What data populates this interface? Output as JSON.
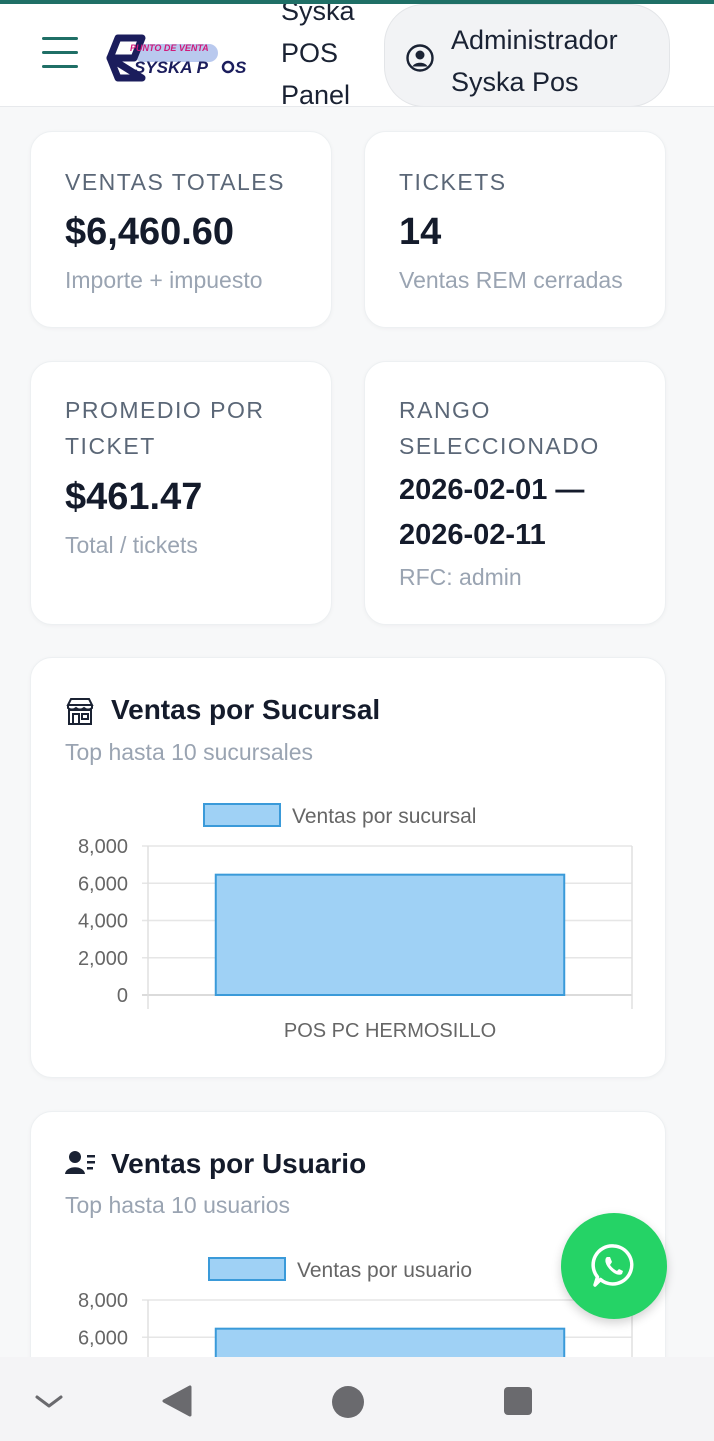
{
  "header": {
    "brand_lines": [
      "Syska",
      "POS",
      "Panel"
    ],
    "user_lines": [
      "Administrador",
      "Syska Pos"
    ],
    "logo_text_top": "PUNTO DE VENTA",
    "logo_text_main": "SYSKA P",
    "logo_text_tail": "S"
  },
  "stats": {
    "ventas": {
      "label": "VENTAS TOTALES",
      "value": "$6,460.60",
      "sub": "Importe + impuesto"
    },
    "tickets": {
      "label": "TICKETS",
      "value": "14",
      "sub": "Ventas REM cerradas"
    },
    "promedio": {
      "label_lines": [
        "PROMEDIO POR",
        "TICKET"
      ],
      "value": "$461.47",
      "sub": "Total / tickets"
    },
    "rango": {
      "label_lines": [
        "RANGO",
        "SELECCIONADO"
      ],
      "value_lines": [
        "2026-02-01 —",
        "2026-02-11"
      ],
      "sub": "RFC: admin"
    }
  },
  "sucursal_section": {
    "title": "Ventas por Sucursal",
    "subtitle": "Top hasta 10 sucursales",
    "icon": "store-icon"
  },
  "usuario_section": {
    "title": "Ventas por Usuario",
    "subtitle": "Top hasta 10 usuarios",
    "icon": "user-list-icon"
  },
  "colors": {
    "accent": "#1f6f66",
    "bar_fill": "#9fd1f5",
    "bar_stroke": "#3a9ad9",
    "whatsapp": "#25d366"
  },
  "chart_data": [
    {
      "type": "bar",
      "categories": [
        "POS PC HERMOSILLO"
      ],
      "series": [
        {
          "name": "Ventas por sucursal",
          "values": [
            6460.6
          ]
        }
      ],
      "ylim": [
        0,
        8000
      ],
      "yticks": [
        "8,000",
        "6,000",
        "4,000",
        "2,000",
        "0"
      ],
      "legend": "top",
      "grid": true
    },
    {
      "type": "bar",
      "categories": [
        ""
      ],
      "series": [
        {
          "name": "Ventas por usuario",
          "values": [
            6460.6
          ]
        }
      ],
      "ylim": [
        0,
        8000
      ],
      "yticks": [
        "8,000",
        "6,000"
      ],
      "legend": "top",
      "grid": true
    }
  ],
  "fab": {
    "icon": "whatsapp-icon"
  },
  "nav": {
    "icons": [
      "chevron-down-icon",
      "back-icon",
      "home-icon",
      "recents-icon"
    ]
  }
}
